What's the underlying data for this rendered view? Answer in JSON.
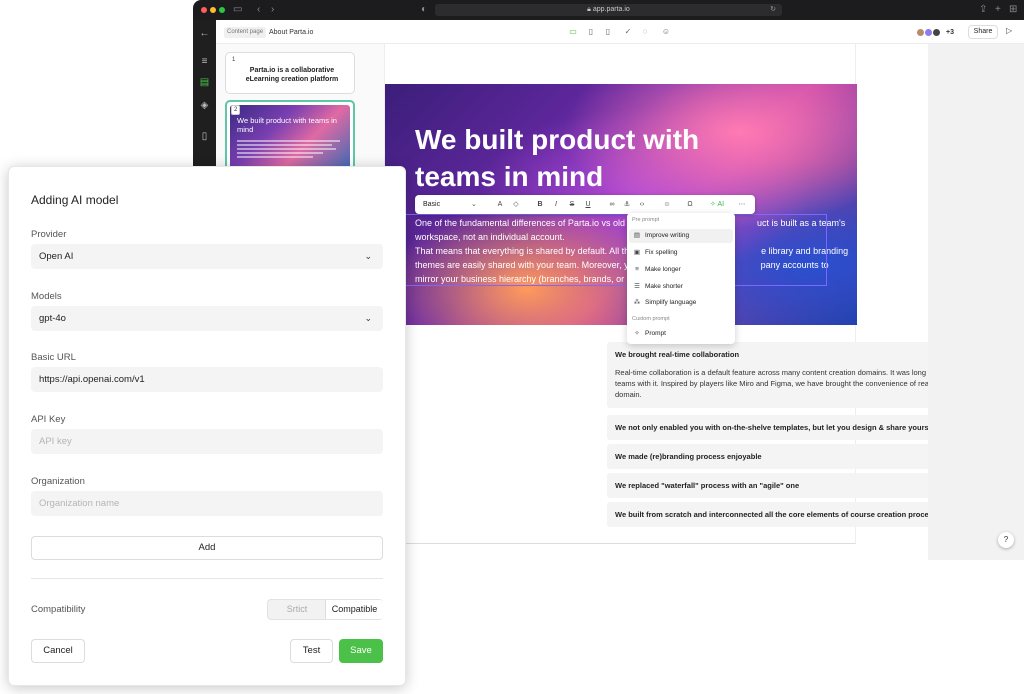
{
  "browser": {
    "url": "app.parta.io",
    "traffic_lights": [
      "#ff5f57",
      "#febc2e",
      "#28c840"
    ]
  },
  "appbar": {
    "content_page_tag": "Content page",
    "page_title": "About Parta.io",
    "extra_collaborators": "+3",
    "share_label": "Share"
  },
  "slides": {
    "slide1": {
      "number": "1",
      "title": "Parta.io is a collaborative eLearning creation platform"
    },
    "slide2": {
      "number": "2",
      "title": "We built product with teams in mind"
    }
  },
  "hero": {
    "title": "We built product with teams in mind",
    "body_line1": "One of the fundamental differences of Parta.io vs old",
    "body_line1_end": "uct is built as a team's",
    "body_line2": "workspace, not an individual account.",
    "body_line3": "That means that everything is shared by default. All th",
    "body_line3_end": "e library and branding",
    "body_line4": "themes are easily shared with your team. Moreover, y",
    "body_line4_end": "pany accounts to",
    "body_line5": "mirror your business hierarchy (branches, brands, or c"
  },
  "toolbar": {
    "style_select": "Basic",
    "ai_label": "AI"
  },
  "prompt_menu": {
    "pre_prompt_header": "Pre prompt",
    "items": [
      "Improve writing",
      "Fix spelling",
      "Make longer",
      "Make shorter",
      "Simplify language"
    ],
    "custom_prompt_header": "Custom prompt",
    "custom_item": "Prompt"
  },
  "accordion": [
    {
      "title": "We brought real-time collaboration",
      "body": "Real-time collaboration is a default feature across many content creation domains. It was long overdue to enable L&D teams with it. Inspired by players like Miro and Figma, we have brought the convenience of real-time to the eLearning domain."
    },
    {
      "title": "We not only enabled you with on-the-shelve templates, but let you design & share yours"
    },
    {
      "title": "We made (re)branding process enjoyable"
    },
    {
      "title": "We replaced \"waterfall\" process with an \"agile\" one"
    },
    {
      "title": "We built from scratch and interconnected all the core elements of course creation process"
    }
  ],
  "help_label": "?",
  "dialog": {
    "title": "Adding AI model",
    "provider_label": "Provider",
    "provider_value": "Open AI",
    "models_label": "Models",
    "models_value": "gpt-4o",
    "basic_url_label": "Basic URL",
    "basic_url_value": "https://api.openai.com/v1",
    "api_key_label": "API Key",
    "api_key_placeholder": "API key",
    "organization_label": "Organization",
    "organization_placeholder": "Organization name",
    "add_label": "Add",
    "compatibility_label": "Compatibility",
    "strict_label": "Srtict",
    "compatible_label": "Compatible",
    "cancel_label": "Cancel",
    "test_label": "Test",
    "save_label": "Save",
    "save_color": "#4cc14a"
  }
}
